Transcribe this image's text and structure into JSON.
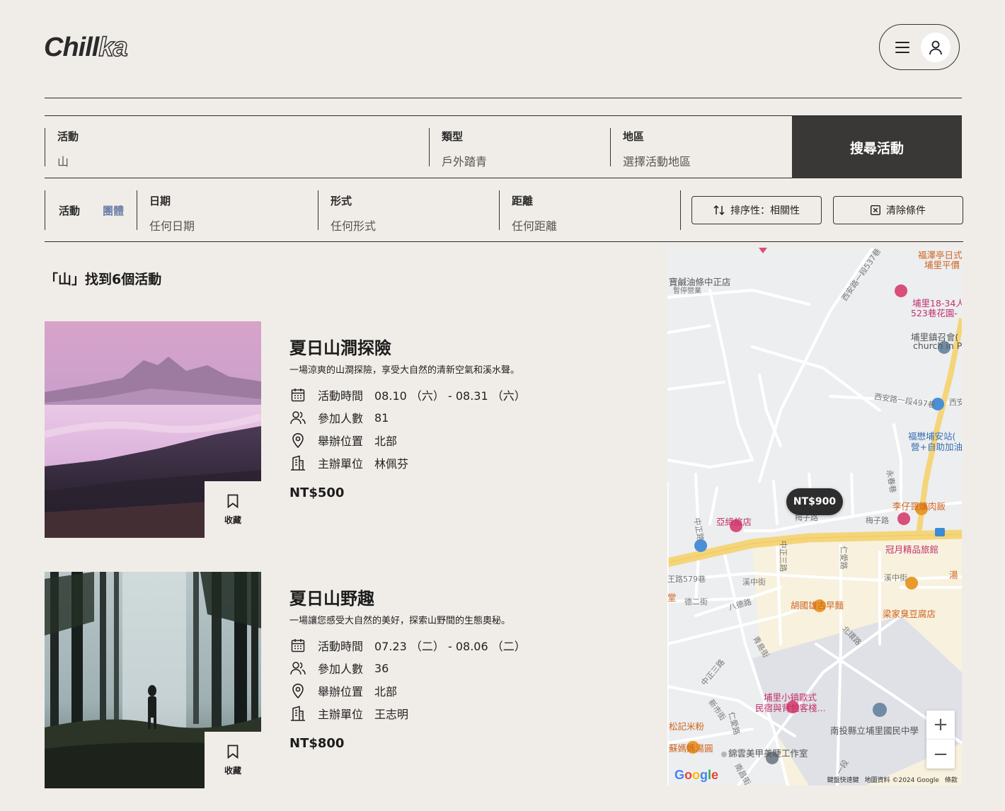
{
  "brand": {
    "logo_main": "Chill",
    "logo_tail": "ka"
  },
  "search": {
    "activity_label": "活動",
    "activity_value": "山",
    "type_label": "類型",
    "type_value": "戶外踏青",
    "region_label": "地區",
    "region_value": "選擇活動地區",
    "submit_label": "搜尋活動"
  },
  "filters": {
    "toggle_activity": "活動",
    "toggle_group": "團體",
    "date_label": "日期",
    "date_value": "任何日期",
    "format_label": "形式",
    "format_value": "任何形式",
    "distance_label": "距離",
    "distance_value": "任何距離",
    "sort_label": "排序性：相關性",
    "clear_label": "清除條件"
  },
  "results": {
    "summary": "「山」找到6個活動",
    "labels": {
      "time": "活動時間",
      "people": "參加人數",
      "location": "舉辦位置",
      "organizer": "主辦單位",
      "save": "收藏"
    },
    "cards": [
      {
        "title": "夏日山澗探險",
        "desc": "一場涼爽的山澗探險，享受大自然的清新空氣和溪水聲。",
        "time": "08.10 （六） - 08.31 （六）",
        "people": "81",
        "location": "北部",
        "organizer": "林佩芬",
        "price": "NT$500"
      },
      {
        "title": "夏日山野趣",
        "desc": "一場讓您感受大自然的美好，探索山野間的生態奧秘。",
        "time": "07.23 （二） - 08.06 （二）",
        "people": "36",
        "location": "北部",
        "organizer": "王志明",
        "price": "NT$800"
      }
    ]
  },
  "map": {
    "price_pin": "NT$900",
    "zoom_in": "+",
    "zoom_out": "−",
    "google": "Google",
    "attr": [
      "鍵盤快速鍵",
      "地圖資料 ©2024 Google",
      "條款"
    ],
    "labels": {
      "l1": "寶鹹油條中正店",
      "l1b": "暫停營業",
      "l2": "西安路一段537巷",
      "l3": "福澤亭日式",
      "l3b": "埔里平價",
      "l4": "埔里18-34人",
      "l4b": "523巷花園-",
      "l5": "埔里鎮召會(",
      "l5b": "church in P",
      "l6": "西安路一段497巷",
      "l6b": "西安",
      "l7": "福懋埔安站(",
      "l7b": "營+自助加油",
      "l8": "永春巷",
      "l9": "李仔哥爌肉飯",
      "l10": "亞締旅店",
      "l11": "梅子路",
      "l11b": "梅子路",
      "l12": "中正路",
      "l13": "冠月精品旅館",
      "l14": "中正三路",
      "l15": "仁愛路",
      "l16": "溪中街",
      "l16b": "溪中街",
      "l17": "王路579巷",
      "l18": "德二街",
      "l19": "八德路",
      "l20": "胡國雄古早麵",
      "l21": "梁家臭豆腐店",
      "l22": "北環路",
      "l23": "青島街",
      "l24": "中正三路",
      "l25": "埔里小鎮歐式",
      "l25b": "民宿與背包客棧...",
      "l26": "新市街",
      "l27": "松記米粉",
      "l28": "仁愛路",
      "l29": "南投縣立埔里國民中學",
      "l30": "蘇媽媽湯圓",
      "l31": "錦雲美甲美睫工作室",
      "l32": "南昌街",
      "l33": "一段",
      "l34": "湯",
      "l35": "堂"
    }
  },
  "colors": {
    "accent_dark": "#3a3836",
    "toggle_active": "#6b7fa8",
    "background": "#f0ede8",
    "map_road": "#f5d57a"
  }
}
